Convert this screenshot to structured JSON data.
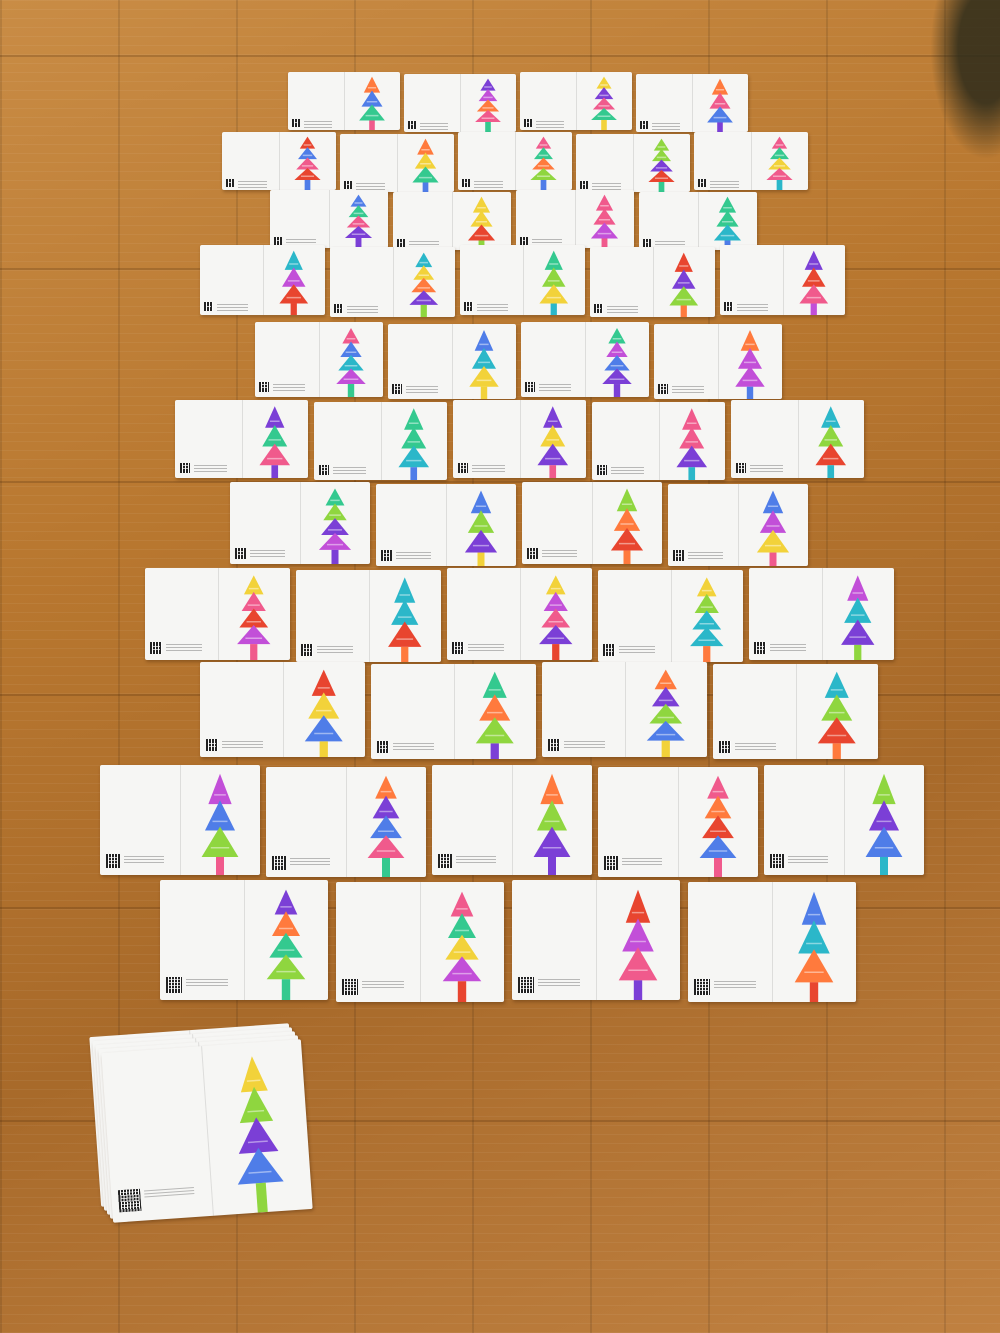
{
  "scene": {
    "description_tag": "photo",
    "floor_color": "#b8772f",
    "card_color": "#f6f6f4",
    "palette": [
      "#7b3fd6",
      "#4f7de8",
      "#34c98f",
      "#8fd63f",
      "#f05a8c",
      "#ff7a3d",
      "#f2d23a",
      "#2bb7c9",
      "#c24fd8",
      "#e8452f"
    ]
  },
  "rows": [
    {
      "count": 4
    },
    {
      "count": 5
    },
    {
      "count": 4
    },
    {
      "count": 5
    },
    {
      "count": 4
    },
    {
      "count": 5
    },
    {
      "count": 4
    },
    {
      "count": 5
    },
    {
      "count": 4
    },
    {
      "count": 5
    },
    {
      "count": 4
    }
  ],
  "stack": {
    "count": 1
  }
}
